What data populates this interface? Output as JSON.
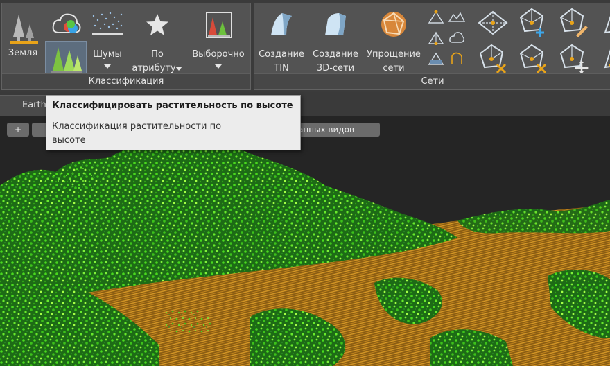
{
  "ribbon": {
    "classification": {
      "title": "Классификация",
      "ground": "Земля",
      "noise": "Шумы",
      "by_attr_1": "По",
      "by_attr_2": "атрибуту",
      "selective": "Выборочно"
    },
    "meshes": {
      "title": "Сети",
      "tin_1": "Создание",
      "tin_2": "TIN",
      "mesh3d_1": "Создание",
      "mesh3d_2": "3D-сети",
      "simplify_1": "Упрощение",
      "simplify_2": "сети"
    }
  },
  "doc_tab": {
    "label": "Earth"
  },
  "viewport": {
    "plus": "+",
    "views_dropdown": "анных видов ---"
  },
  "tooltip": {
    "title": "Классифицировать растительность по высоте",
    "description": "Классификация растительности по высоте"
  },
  "colors": {
    "ground_points": "#c58a1c",
    "vegetation_points": "#4fe21f",
    "ribbon_bg": "#535353"
  }
}
